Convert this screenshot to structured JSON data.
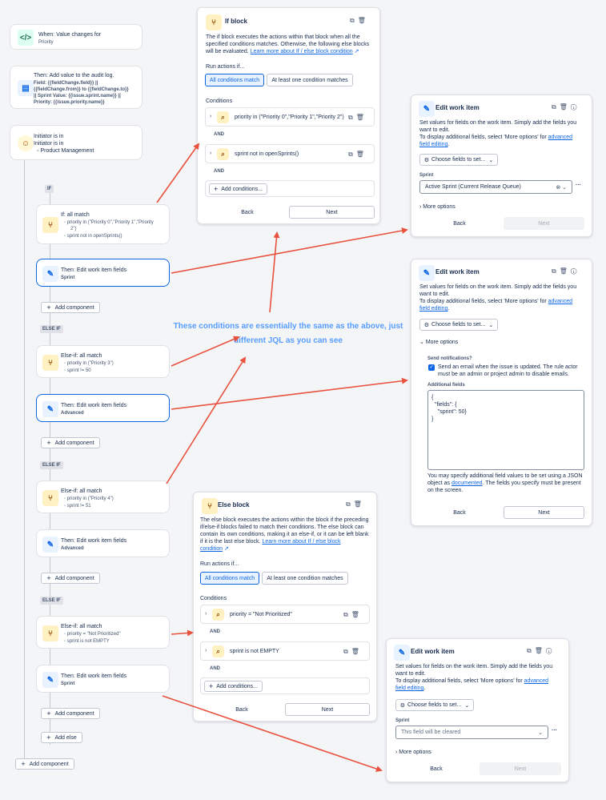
{
  "flow": {
    "trigger": {
      "title": "When: Value changes for",
      "sub": "Priority"
    },
    "audit": {
      "title": "Then: Add value to the audit log.",
      "lines": [
        "Field: {{fieldChange.field}} ||",
        "{{fieldChange.from}} to {{fieldChange.to}}",
        "|| Sprint Value: {{issue.sprint.name}} ||",
        "Priority: {{issue.priority.name}}"
      ]
    },
    "initiator": {
      "title": "Initiator is in",
      "sub": "Initiator is in",
      "value": "Product Management"
    },
    "if_tag": "IF",
    "if1": {
      "title": "If: all match",
      "b1": "priority in (\"Priority 0\",\"Priority 1\",\"Priority",
      "b1b": "2\")",
      "b2": "sprint not in openSprints()"
    },
    "then1": {
      "title": "Then: Edit work item fields",
      "sub": "Sprint"
    },
    "add_component": "Add component",
    "elseif_tag": "ELSE IF",
    "elseif1": {
      "title": "Else-if: all match",
      "b1": "priority in (\"Priority 3\")",
      "b2": "sprint != 50"
    },
    "then2": {
      "title": "Then: Edit work item fields",
      "sub": "Advanced"
    },
    "elseif2": {
      "title": "Else-if: all match",
      "b1": "priority in (\"Priority 4\")",
      "b2": "sprint != 51"
    },
    "then3": {
      "title": "Then: Edit work item fields",
      "sub": "Advanced"
    },
    "elseif3": {
      "title": "Else-if: all match",
      "b1": "priority = \"Not Prioritized\"",
      "b2": "sprint is not EMPTY"
    },
    "then4": {
      "title": "Then: Edit work item fields",
      "sub": "Sprint"
    },
    "add_else": "Add else"
  },
  "if_block": {
    "title": "If block",
    "desc1": "The if block executes the actions within that block when all the",
    "desc2": "specified conditions matches. Otherwise, the following else blocks",
    "desc3": "will be evaluated.",
    "link": "Learn more about If / else block condition",
    "run_label": "Run actions if...",
    "opt_all": "All conditions match",
    "opt_one": "At least one condition matches",
    "cond_label": "Conditions",
    "cond1": "priority in (\"Priority 0\",\"Priority 1\",\"Priority 2\")",
    "cond2": "sprint not in openSprints()",
    "and": "AND",
    "add_cond": "Add conditions...",
    "back": "Back",
    "next": "Next"
  },
  "else_block": {
    "title": "Else block",
    "desc1": "The else block executes the actions within the block if the preceding",
    "desc2": "if/else-if blocks failed to match their conditions. The else block can",
    "desc3": "contain its own conditions, making it an else-if, or it can be left blank",
    "desc4": "if it is the last else block.",
    "link1": "Learn more about If / else block",
    "link2": "condition",
    "run_label": "Run actions if...",
    "opt_all": "All conditions match",
    "opt_one": "At least one condition matches",
    "cond_label": "Conditions",
    "cond1": "priority = \"Not Prioritized\"",
    "cond2": "sprint is not EMPTY",
    "and": "AND",
    "add_cond": "Add conditions...",
    "back": "Back",
    "next": "Next"
  },
  "edit1": {
    "title": "Edit work item",
    "d1": "Set values for fields on the work item. Simply add the fields you",
    "d2": "want to edit.",
    "d3": "To display additional fields, select 'More options' for",
    "link1": "advanced",
    "link2": "field editing",
    "choose": "Choose fields to set...",
    "sprint_label": "Sprint",
    "sprint_value": "Active Sprint (Current Release Queue)",
    "more": "More options",
    "back": "Back",
    "next": "Next"
  },
  "edit2": {
    "title": "Edit work item",
    "d1": "Set values for fields on the work item. Simply add the fields you",
    "d2": "want to edit.",
    "d3": "To display additional fields, select 'More options' for",
    "link1": "advanced",
    "link2": "field editing",
    "choose": "Choose fields to set...",
    "more": "More options",
    "notif_label": "Send notifications?",
    "notif1": "Send an email when the issue is updated. The rule actor",
    "notif2": "must be an admin or project admin to disable emails.",
    "add_fields": "Additional fields",
    "json1": "{",
    "json2": "  \"fields\": {",
    "json3": "    \"sprint\": 50}",
    "json4": "}",
    "f1": "You may specify additional field values to be set using a JSON",
    "f2": "object as",
    "f2link": "documented",
    "f2b": ". The fields you specify must be present",
    "f3": "on the screen.",
    "back": "Back",
    "next": "Next"
  },
  "edit3": {
    "title": "Edit work item",
    "d1": "Set values for fields on the work item. Simply add the fields you",
    "d2": "want to edit.",
    "d3": "To display additional fields, select 'More options' for",
    "link1": "advanced",
    "link2": "field editing",
    "choose": "Choose fields to set...",
    "sprint_label": "Sprint",
    "sprint_value": "This field will be cleared",
    "more": "More options",
    "back": "Back",
    "next": "Next"
  },
  "annotation": {
    "line1": "These conditions are essentially the same as the above, just",
    "line2": "different JQL as you can see"
  },
  "colors": {
    "arrow": "#e8523f",
    "accent": "#0c66e4",
    "annotation": "#579dff"
  }
}
